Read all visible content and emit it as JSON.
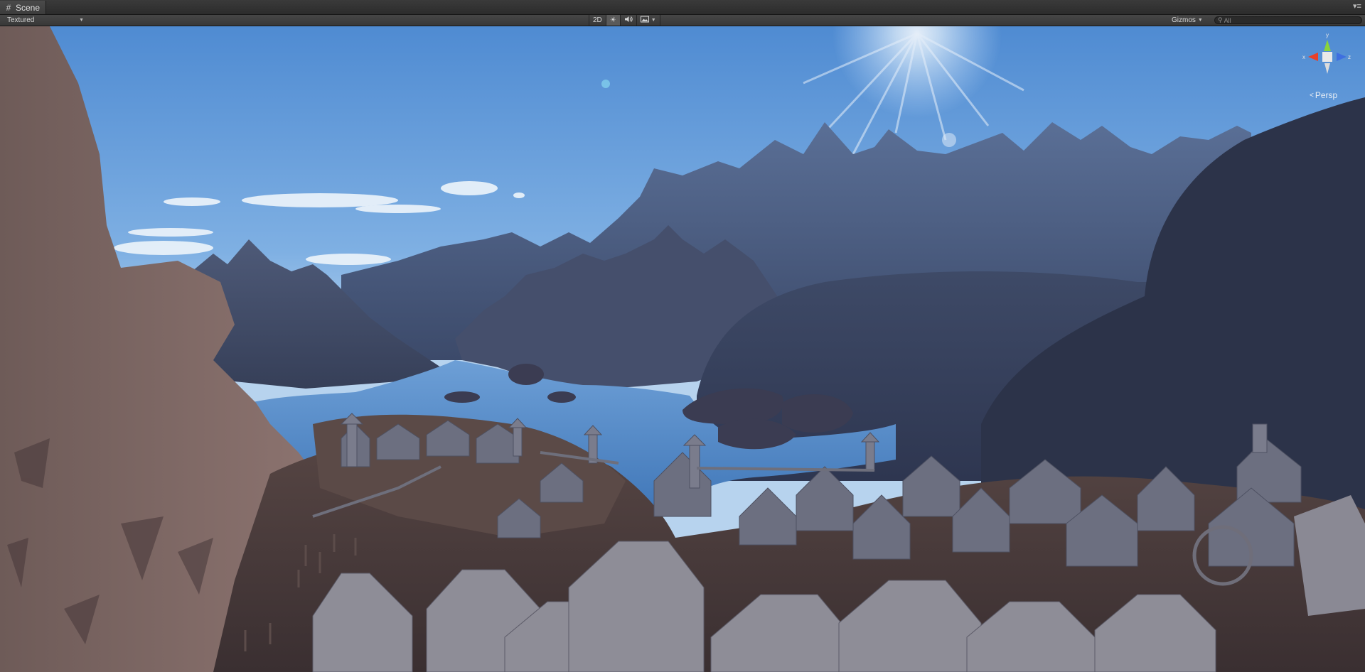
{
  "window": {
    "tab_title": "Scene"
  },
  "toolbar": {
    "render_mode": "Textured",
    "toggle_2d": "2D",
    "lighting_icon": "sun-icon",
    "audio_icon": "speaker-icon",
    "effects_icon": "image-icon",
    "gizmos_label": "Gizmos",
    "search_placeholder": "All"
  },
  "viewport": {
    "projection_label": "Persp",
    "gizmo_axes": {
      "x": "x",
      "y": "y",
      "z": "z"
    },
    "colors": {
      "x_axis": "#e8412a",
      "y_axis": "#8ad43b",
      "z_axis": "#3e6fe0",
      "sky_top": "#5a93d6",
      "sky_horizon": "#b9d5ee",
      "water": "#4f86c4"
    }
  }
}
